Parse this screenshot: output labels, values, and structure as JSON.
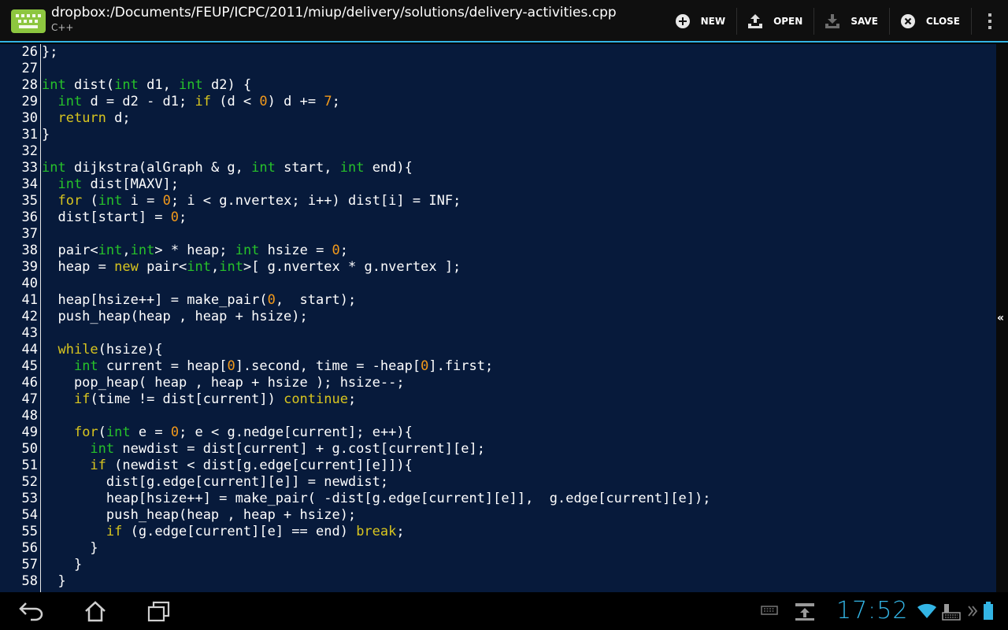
{
  "header": {
    "title": "dropbox:/Documents/FEUP/ICPC/2011/miup/delivery/solutions/delivery-activities.cpp",
    "subtitle": "C++",
    "actions": {
      "new": "NEW",
      "open": "OPEN",
      "save": "SAVE",
      "close": "CLOSE"
    }
  },
  "editor": {
    "colors": {
      "background": "#071a3b",
      "keyword": "#d8c51f",
      "type": "#27c22a",
      "number": "#f39a1b",
      "text": "#ffffff"
    },
    "lines": [
      {
        "n": "26",
        "code": "};"
      },
      {
        "n": "27",
        "code": ""
      },
      {
        "n": "28",
        "code": "int dist(int d1, int d2) {"
      },
      {
        "n": "29",
        "code": "  int d = d2 - d1; if (d < 0) d += 7;"
      },
      {
        "n": "30",
        "code": "  return d;"
      },
      {
        "n": "31",
        "code": "}"
      },
      {
        "n": "32",
        "code": ""
      },
      {
        "n": "33",
        "code": "int dijkstra(alGraph & g, int start, int end){"
      },
      {
        "n": "34",
        "code": "  int dist[MAXV];"
      },
      {
        "n": "35",
        "code": "  for (int i = 0; i < g.nvertex; i++) dist[i] = INF;"
      },
      {
        "n": "36",
        "code": "  dist[start] = 0;"
      },
      {
        "n": "37",
        "code": ""
      },
      {
        "n": "38",
        "code": "  pair<int,int> * heap; int hsize = 0;"
      },
      {
        "n": "39",
        "code": "  heap = new pair<int,int>[ g.nvertex * g.nvertex ];"
      },
      {
        "n": "40",
        "code": ""
      },
      {
        "n": "41",
        "code": "  heap[hsize++] = make_pair(0,  start);"
      },
      {
        "n": "42",
        "code": "  push_heap(heap , heap + hsize);"
      },
      {
        "n": "43",
        "code": ""
      },
      {
        "n": "44",
        "code": "  while(hsize){"
      },
      {
        "n": "45",
        "code": "    int current = heap[0].second, time = -heap[0].first;"
      },
      {
        "n": "46",
        "code": "    pop_heap( heap , heap + hsize ); hsize--;"
      },
      {
        "n": "47",
        "code": "    if(time != dist[current]) continue;"
      },
      {
        "n": "48",
        "code": ""
      },
      {
        "n": "49",
        "code": "    for(int e = 0; e < g.nedge[current]; e++){"
      },
      {
        "n": "50",
        "code": "      int newdist = dist[current] + g.cost[current][e];"
      },
      {
        "n": "51",
        "code": "      if (newdist < dist[g.edge[current][e]]){"
      },
      {
        "n": "52",
        "code": "        dist[g.edge[current][e]] = newdist;"
      },
      {
        "n": "53",
        "code": "        heap[hsize++] = make_pair( -dist[g.edge[current][e]],  g.edge[current][e]);"
      },
      {
        "n": "54",
        "code": "        push_heap(heap , heap + hsize);"
      },
      {
        "n": "55",
        "code": "        if (g.edge[current][e] == end) break;"
      },
      {
        "n": "56",
        "code": "      }"
      },
      {
        "n": "57",
        "code": "    }"
      },
      {
        "n": "58",
        "code": "  }"
      }
    ]
  },
  "statusbar": {
    "time": "17:52"
  }
}
